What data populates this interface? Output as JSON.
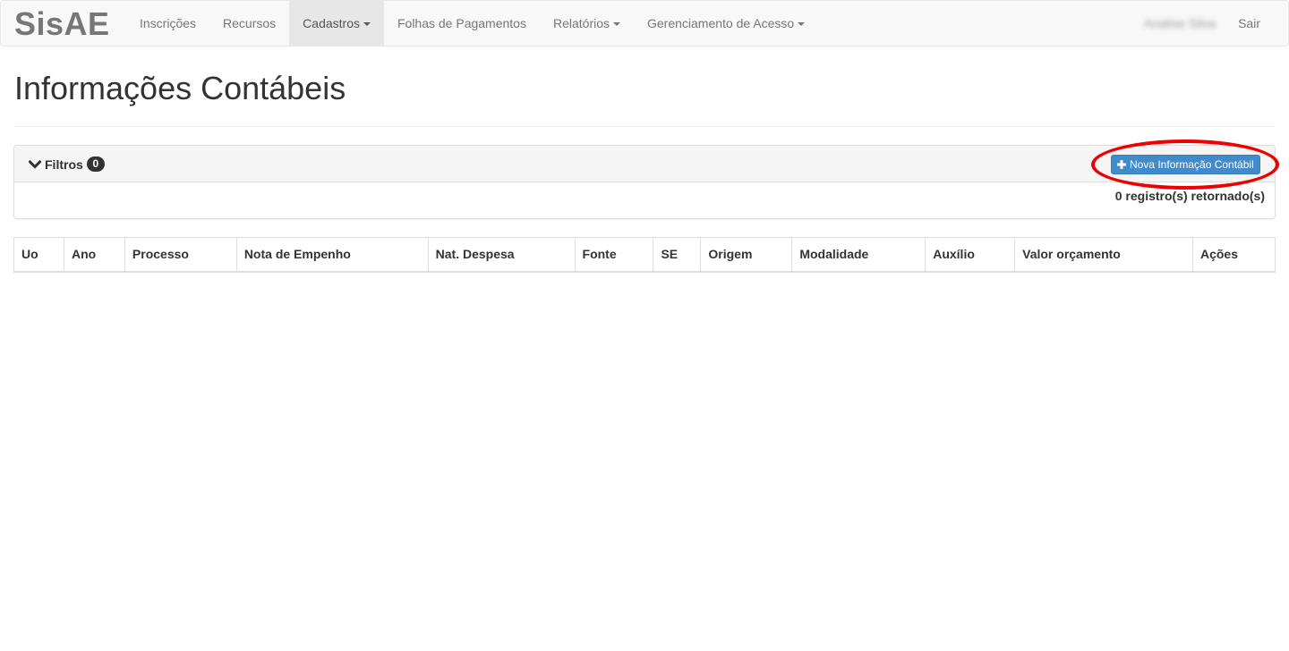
{
  "navbar": {
    "brand": "SisAE",
    "items": [
      {
        "label": "Inscrições",
        "dropdown": false,
        "active": false
      },
      {
        "label": "Recursos",
        "dropdown": false,
        "active": false
      },
      {
        "label": "Cadastros",
        "dropdown": true,
        "active": true
      },
      {
        "label": "Folhas de Pagamentos",
        "dropdown": false,
        "active": false
      },
      {
        "label": "Relatórios",
        "dropdown": true,
        "active": false
      },
      {
        "label": "Gerenciamento de Acesso",
        "dropdown": true,
        "active": false
      }
    ],
    "user_name": "Analise Silva",
    "exit_label": "Sair"
  },
  "page": {
    "title": "Informações Contábeis"
  },
  "filters": {
    "label": "Filtros",
    "badge_count": "0",
    "new_button_label": "Nova Informação Contábil",
    "record_count": "0 registro(s) retornado(s)"
  },
  "table": {
    "columns": [
      "Uo",
      "Ano",
      "Processo",
      "Nota de Empenho",
      "Nat. Despesa",
      "Fonte",
      "SE",
      "Origem",
      "Modalidade",
      "Auxílio",
      "Valor orçamento",
      "Ações"
    ],
    "rows": []
  },
  "colors": {
    "primary": "#428bca",
    "highlight": "#ee0000"
  }
}
